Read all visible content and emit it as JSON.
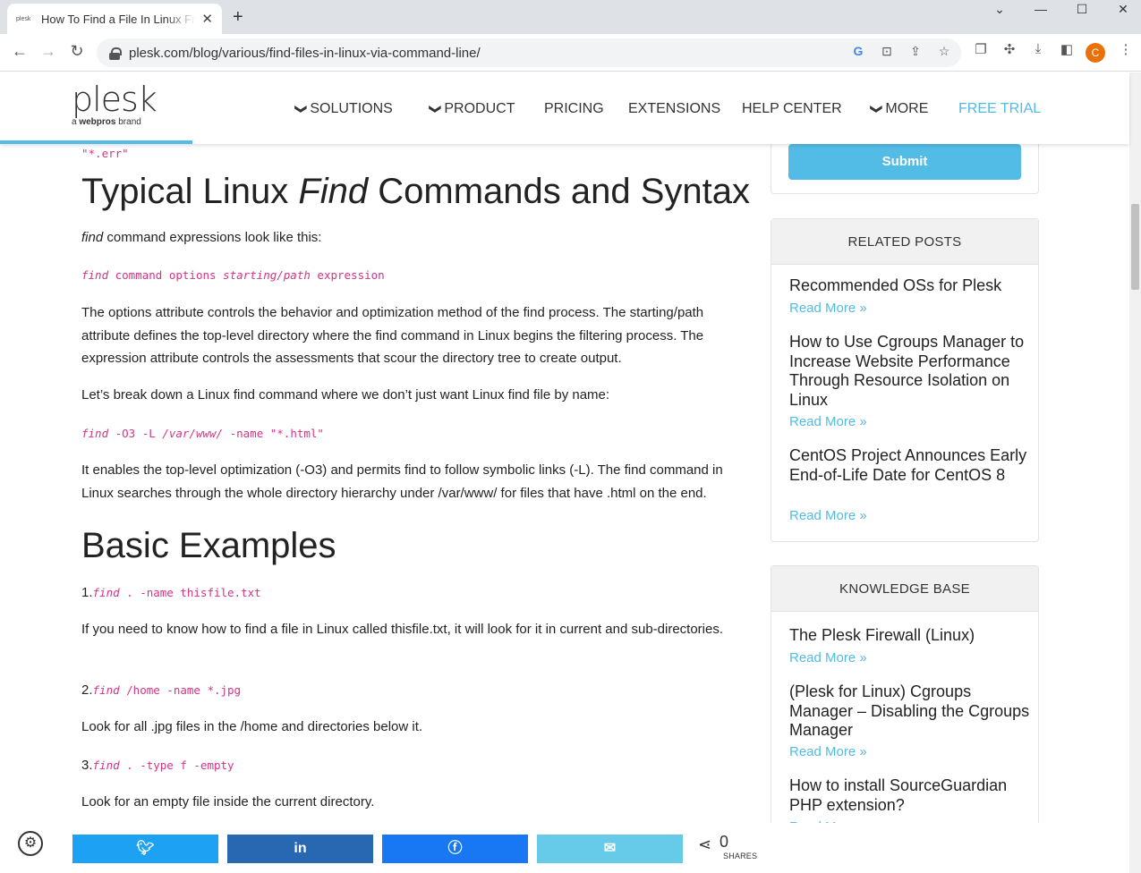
{
  "browser": {
    "tab_title": "How To Find a File In Linux From the Command Line",
    "favicon_text": "plesk",
    "url": "plesk.com/blog/various/find-files-in-linux-via-command-line/",
    "avatar_letter": "C"
  },
  "site": {
    "logo": "plesk",
    "logo_sub_prefix": "a",
    "logo_sub_brand": "webpros",
    "logo_sub_suffix": "brand",
    "nav": {
      "solutions": "SOLUTIONS",
      "product": "PRODUCT",
      "pricing": "PRICING",
      "extensions": "EXTENSIONS",
      "help_center": "HELP CENTER",
      "more": "MORE",
      "free_trial": "FREE TRIAL"
    }
  },
  "article": {
    "code0": "\"*.err\"",
    "h_typical_a": "Typical Linux ",
    "h_typical_em": "Find",
    "h_typical_b": " Commands and Syntax",
    "p1_em": "find",
    "p1": " command expressions look like this:",
    "code1_a": "find",
    "code1_b": " command options ",
    "code1_c": "starting/path",
    "code1_d": " expression",
    "p2": "The options attribute controls the behavior and optimization method of the find process. The starting/path attribute defines the top-level directory where the find command in Linux begins the filtering process. The expression attribute controls the assessments that scour the directory tree to create output.",
    "p3": "Let’s break down a Linux find command where we don’t just want Linux find file by name:",
    "code2_a": "find",
    "code2_b": " -O3 -L ",
    "code2_c": "/var/www/",
    "code2_d": " -name \"*.html\"",
    "p4": "It enables the top-level optimization (-O3) and permits find to follow symbolic links (-L). The find command in Linux searches through the whole directory hierarchy under /var/www/ for files that have .html on the end.",
    "h_basic": "Basic Examples",
    "ex1_num": "1.",
    "ex1_a": "find",
    "ex1_b": " . -name thisfile.txt",
    "ex1_desc": "If you need to know how to find a file in Linux called thisfile.txt, it will look for it in current and sub-directories.",
    "ex2_num": "2.",
    "ex2_a": "find",
    "ex2_b": " /home -name *.jpg",
    "ex2_desc": "Look for all .jpg files in the /home and directories below it.",
    "ex3_num": "3.",
    "ex3_a": "find",
    "ex3_b": " . -type f -empty",
    "ex3_desc": "Look for an empty file inside the current directory."
  },
  "sidebar": {
    "submit": "Submit",
    "related_title": "RELATED POSTS",
    "related": [
      {
        "title": "Recommended OSs for Plesk",
        "more": "Read More »"
      },
      {
        "title": "How to Use Cgroups Manager to Increase Website Performance Through Resource Isolation on Linux",
        "more": "Read More »"
      },
      {
        "title": "CentOS Project Announces Early End-of-Life Date for CentOS 8",
        "more": "Read More »"
      }
    ],
    "kb_title": "KNOWLEDGE BASE",
    "kb": [
      {
        "title": "The Plesk Firewall (Linux)",
        "more": "Read More »"
      },
      {
        "title": "(Plesk for Linux) Cgroups Manager – Disabling the Cgroups Manager",
        "more": "Read More »"
      },
      {
        "title": "How to install SourceGuardian PHP extension?",
        "more": "Read More »"
      }
    ]
  },
  "share": {
    "count": "0",
    "label": "SHARES",
    "colors": {
      "twitter": "#1da1f2",
      "linkedin": "#2867b2",
      "facebook": "#1877f2",
      "email": "#65cbe9"
    }
  }
}
